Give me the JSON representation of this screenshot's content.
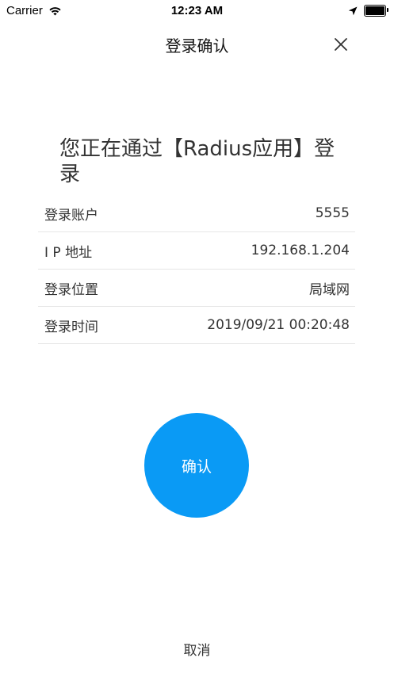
{
  "status_bar": {
    "carrier": "Carrier",
    "time": "12:23 AM",
    "battery_level": 1.0
  },
  "nav": {
    "title": "登录确认",
    "close_icon": "close-icon"
  },
  "heading": "您正在通过【Radius应用】登录",
  "info": [
    {
      "label": "登录账户",
      "value": "5555"
    },
    {
      "label": "I P 地址",
      "value": "192.168.1.204"
    },
    {
      "label": "登录位置",
      "value": "局域网"
    },
    {
      "label": "登录时间",
      "value": "2019/09/21 00:20:48"
    }
  ],
  "confirm_label": "确认",
  "cancel_label": "取消",
  "colors": {
    "accent": "#0a9af5",
    "divider": "#e6e6e6"
  }
}
